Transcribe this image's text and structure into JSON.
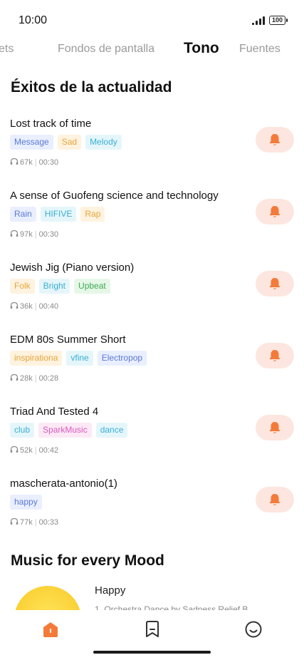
{
  "status_bar": {
    "time": "10:00",
    "battery": "100"
  },
  "tabs": [
    {
      "label": "ets"
    },
    {
      "label": "Fondos de pantalla"
    },
    {
      "label": "Tono"
    },
    {
      "label": "Fuentes"
    }
  ],
  "active_tab": "Tono",
  "section_hits": {
    "title": "Éxitos de la actualidad"
  },
  "songs": [
    {
      "title": "Lost track of time",
      "tags": [
        {
          "label": "Message",
          "color": "blue"
        },
        {
          "label": "Sad",
          "color": "orange"
        },
        {
          "label": "Melody",
          "color": "cyan"
        }
      ],
      "plays": "67k",
      "duration": "00:30"
    },
    {
      "title": "A sense of Guofeng science and technology",
      "tags": [
        {
          "label": "Rain",
          "color": "blue"
        },
        {
          "label": "HIFIVE",
          "color": "cyan"
        },
        {
          "label": "Rap",
          "color": "orange"
        }
      ],
      "plays": "97k",
      "duration": "00:30"
    },
    {
      "title": "Jewish Jig (Piano version)",
      "tags": [
        {
          "label": "Folk",
          "color": "orange"
        },
        {
          "label": "Bright",
          "color": "cyan"
        },
        {
          "label": "Upbeat",
          "color": "green"
        }
      ],
      "plays": "36k",
      "duration": "00:40"
    },
    {
      "title": "EDM 80s Summer Short",
      "tags": [
        {
          "label": "inspirationa",
          "color": "orange"
        },
        {
          "label": "vfine",
          "color": "cyan"
        },
        {
          "label": "Electropop",
          "color": "blue"
        }
      ],
      "plays": "28k",
      "duration": "00:28"
    },
    {
      "title": "Triad And Tested 4",
      "tags": [
        {
          "label": "club",
          "color": "cyan"
        },
        {
          "label": "SparkMusic",
          "color": "pink"
        },
        {
          "label": "dance",
          "color": "cyan"
        }
      ],
      "plays": "52k",
      "duration": "00:42"
    },
    {
      "title": "mascherata-antonio(1)",
      "tags": [
        {
          "label": "happy",
          "color": "blue"
        }
      ],
      "plays": "77k",
      "duration": "00:33"
    }
  ],
  "section_mood": {
    "title": "Music for every Mood",
    "items": [
      {
        "title": "Happy",
        "subtitle": "1. Orchestra Dance by Sadness Relief B..."
      }
    ]
  },
  "colors": {
    "accent": "#f47a3a",
    "bell_bg": "#fde6df",
    "tag_palette": {
      "blue": {
        "bg": "#e9efff",
        "fg": "#5b78d6"
      },
      "orange": {
        "bg": "#fff3df",
        "fg": "#e6a53a"
      },
      "cyan": {
        "bg": "#e5f6fb",
        "fg": "#3aaed3"
      },
      "green": {
        "bg": "#e6f7e8",
        "fg": "#3eab55"
      },
      "pink": {
        "bg": "#fde9f6",
        "fg": "#d65bbd"
      }
    }
  },
  "icons": {
    "ringtone_button": "bell-icon",
    "plays": "headphones-icon",
    "nav": [
      "home-icon",
      "bookmark-icon",
      "smiley-icon"
    ]
  }
}
